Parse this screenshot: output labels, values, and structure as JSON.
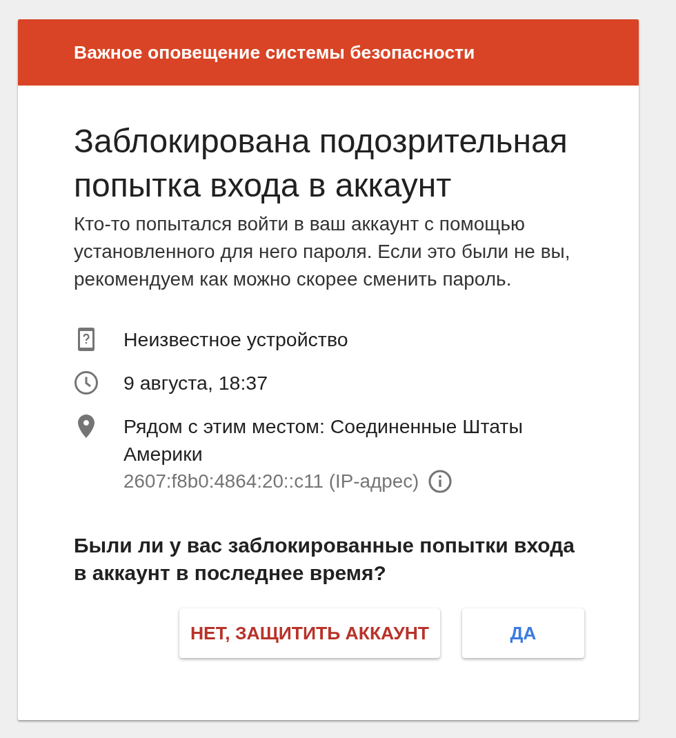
{
  "alert_header": {
    "title": "Важное оповещение системы безопасности"
  },
  "heading": "Заблокирована подозрительная попытка входа в аккаунт",
  "description": "Кто-то попытался войти в ваш аккаунт с помощью установленного для него пароля. Если это были не вы, рекомендуем как можно скорее сменить пароль.",
  "details": [
    {
      "kind": "device",
      "text": "Неизвестное устройство"
    },
    {
      "kind": "time",
      "text": "9 августа, 18:37"
    },
    {
      "kind": "location",
      "text": "Рядом с этим местом: Соединенные Штаты Америки",
      "ip": "2607:f8b0:4864:20::c11 (IP-адрес)"
    }
  ],
  "question": "Были ли у вас заблокированные попытки входа в аккаунт в последнее время?",
  "buttons": [
    {
      "kind": "secure",
      "label": "НЕТ, ЗАЩИТИТЬ АККАУНТ"
    },
    {
      "kind": "confirm",
      "label": "ДА"
    }
  ]
}
